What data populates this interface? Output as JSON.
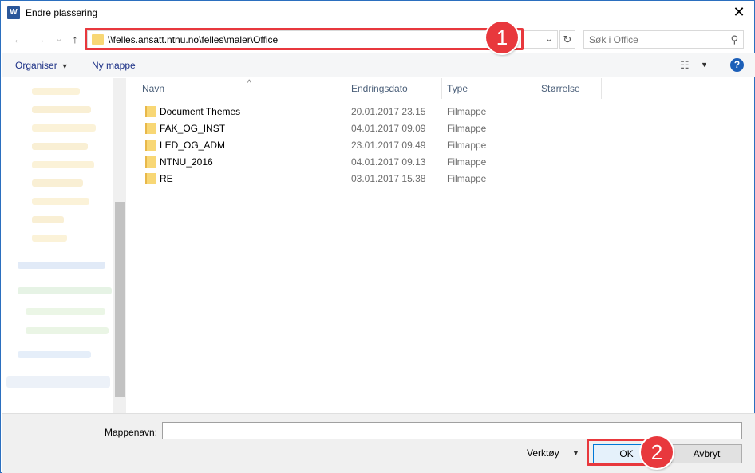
{
  "window": {
    "title": "Endre plassering",
    "app_icon": "W",
    "close_glyph": "✕"
  },
  "nav": {
    "back_glyph": "←",
    "forward_glyph": "→",
    "recent_glyph": "⌄",
    "up_glyph": "↑",
    "address": "\\\\felles.ansatt.ntnu.no\\felles\\maler\\Office",
    "address_dropdown_glyph": "⌄",
    "refresh_glyph": "↻",
    "search_placeholder": "Søk i Office",
    "search_glyph": "⚲"
  },
  "toolbar": {
    "organize_label": "Organiser",
    "organize_caret": "▼",
    "new_folder_label": "Ny mappe",
    "view_glyph": "☷",
    "view_caret": "▼",
    "help_glyph": "?"
  },
  "columns": {
    "name": "Navn",
    "date": "Endringsdato",
    "type": "Type",
    "size": "Størrelse",
    "sort_glyph": "^"
  },
  "rows": [
    {
      "name": "Document Themes",
      "date": "20.01.2017 23.15",
      "type": "Filmappe"
    },
    {
      "name": "FAK_OG_INST",
      "date": "04.01.2017 09.09",
      "type": "Filmappe"
    },
    {
      "name": "LED_OG_ADM",
      "date": "23.01.2017 09.49",
      "type": "Filmappe"
    },
    {
      "name": "NTNU_2016",
      "date": "04.01.2017 09.13",
      "type": "Filmappe"
    },
    {
      "name": "RE",
      "date": "03.01.2017 15.38",
      "type": "Filmappe"
    }
  ],
  "bottom": {
    "folder_name_label": "Mappenavn:",
    "folder_name_value": "",
    "tools_label": "Verktøy",
    "tools_caret": "▼",
    "ok_label": "OK",
    "cancel_label": "Avbryt"
  },
  "annotations": {
    "badge_1": "1",
    "badge_2": "2"
  },
  "colors": {
    "highlight": "#e8383d",
    "folder": "#f8d775",
    "accent": "#1c5fb8"
  }
}
